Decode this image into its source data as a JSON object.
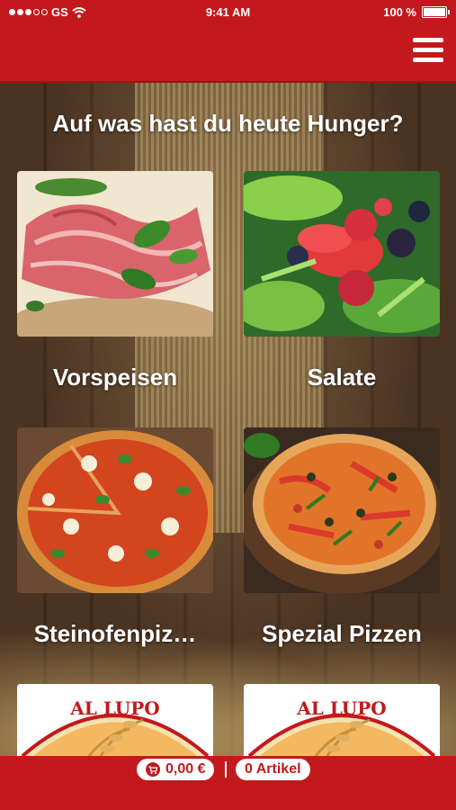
{
  "status_bar": {
    "carrier": "GS",
    "time": "9:41 AM",
    "battery": "100 %"
  },
  "main": {
    "heading": "Auf was hast du heute Hunger?",
    "categories": [
      {
        "label": "Vorspeisen",
        "image": "prosciutto-photo"
      },
      {
        "label": "Salate",
        "image": "salad-photo"
      },
      {
        "label": "Steinofenpiz…",
        "image": "stone-oven-pizza-photo"
      },
      {
        "label": "Spezial Pizzen",
        "image": "special-pizza-photo"
      }
    ],
    "logos": [
      {
        "text": "AL LUPO"
      },
      {
        "text": "AL LUPO"
      }
    ]
  },
  "cart": {
    "total": "0,00 €",
    "items": "0 Artikel"
  },
  "colors": {
    "brand": "#c3191c",
    "text": "#ffffff"
  }
}
